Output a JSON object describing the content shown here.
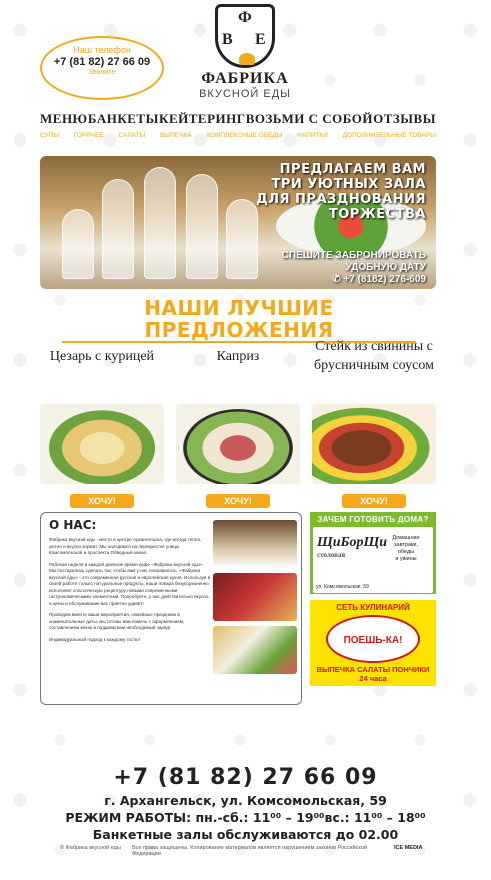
{
  "header": {
    "phone_label": "Наш телефон",
    "phone": "+7 (81 82) 27 66 09",
    "call_label": "Звоните",
    "logo_letters": [
      "Ф",
      "В",
      "Е"
    ],
    "brand_name": "ФАБРИКА",
    "brand_sub": "ВКУСНОЙ ЕДЫ"
  },
  "nav": [
    "МЕНЮ",
    "БАНКЕТЫ",
    "КЕЙТЕРИНГ",
    "ВОЗЬМИ С СОБОЙ",
    "ОТЗЫВЫ"
  ],
  "subnav": [
    "СУПЫ",
    "ГОРЯЧЕЕ",
    "САЛАТЫ",
    "ВЫПЕЧКА",
    "КОМПЛЕКСНЫЕ ОБЕДЫ",
    "НАПИТКИ",
    "ДОПОЛНИТЕЛЬНЫЕ ТОВАРЫ"
  ],
  "banner": {
    "headline": [
      "ПРЕДЛАГАЕМ ВАМ",
      "ТРИ УЮТНЫХ ЗАЛА",
      "ДЛЯ ПРАЗДНОВАНИЯ",
      "ТОРЖЕСТВА"
    ],
    "cta": [
      "СПЕШИТЕ ЗАБРОНИРОВАТЬ",
      "УДОБНУЮ ДАТУ"
    ],
    "phone": "+7 (8182) 276-609"
  },
  "offers": {
    "title": "НАШИ ЛУЧШИЕ ПРЕДЛОЖЕНИЯ",
    "items": [
      {
        "name": "Цезарь с курицей",
        "button": "ХОЧУ!"
      },
      {
        "name": "Каприз",
        "button": "ХОЧУ!"
      },
      {
        "name": "Стейк из свинины с брусничным соусом",
        "button": "ХОЧУ!"
      }
    ]
  },
  "about": {
    "title": "О НАС:",
    "paragraphs": [
      "Фабрика вкусной еды - место в центре Архангельска, где всегда тепло, уютно и вкусно кормят. Мы находимся на перекрестке улицы Комсомольской и проспекта Обводный канал.",
      "Рабочая неделя в каждой дневное время кафе «Фабрика вкусной еды». Мы постарались сделать так, чтобы вам у нас понравилось. «Фабрика вкусной еды» - это современная русская и европейская кухня. Используя в своей работе только натуральные продукты, наши повара безукоризненно исполняют классическую рецептуру новыми современными гастрономическими элементами. Попробуйте, у нас действительно вкусно, а цены и обслуживание вас приятно удивят!",
      "Проводим вместе ваши мероприятия, семейные праздники и знаменательные даты, мы готовы вам помочь с оформлением, составлением меню и подарим вам необходимый заряд!",
      "Индивидуальный подход к каждому гостю!"
    ]
  },
  "promo1": {
    "title": "ЗАЧЕМ ГОТОВИТЬ ДОМА?",
    "brand": "ЩиБорЩи",
    "brand_sub": "столовая",
    "side": [
      "Домашние",
      "завтраки,",
      "обеды",
      "и ужины"
    ],
    "address": "ул. Комсомольская, 59"
  },
  "promo2": {
    "title": "СЕТЬ КУЛИНАРИЙ",
    "logo": "ПОЕШЬ-КА!",
    "bottom": [
      "ВЫПЕЧКА САЛАТЫ ПОНЧИКИ",
      "24 часа"
    ]
  },
  "footer": {
    "phone": "+7 (81 82) 27 66 09",
    "address": "г. Архангельск, ул. Комсомольская, 59",
    "hours": "РЕЖИМ РАБОТЫ: пн.-сб.: 11⁰⁰ – 19⁰⁰вс.: 11⁰⁰ – 18⁰⁰",
    "banquet": "Банкетные залы обслуживаются до 02.00",
    "copyright": "© Фабрика вкусной еды",
    "rights": "Все права защищены. Копирование материалов является нарушением законов Российской Федерации",
    "dev": "ICE MEDIA"
  },
  "colors": {
    "accent": "#f4a81b",
    "green": "#7dba2c",
    "yellow": "#ffe300",
    "red": "#d0191d"
  }
}
